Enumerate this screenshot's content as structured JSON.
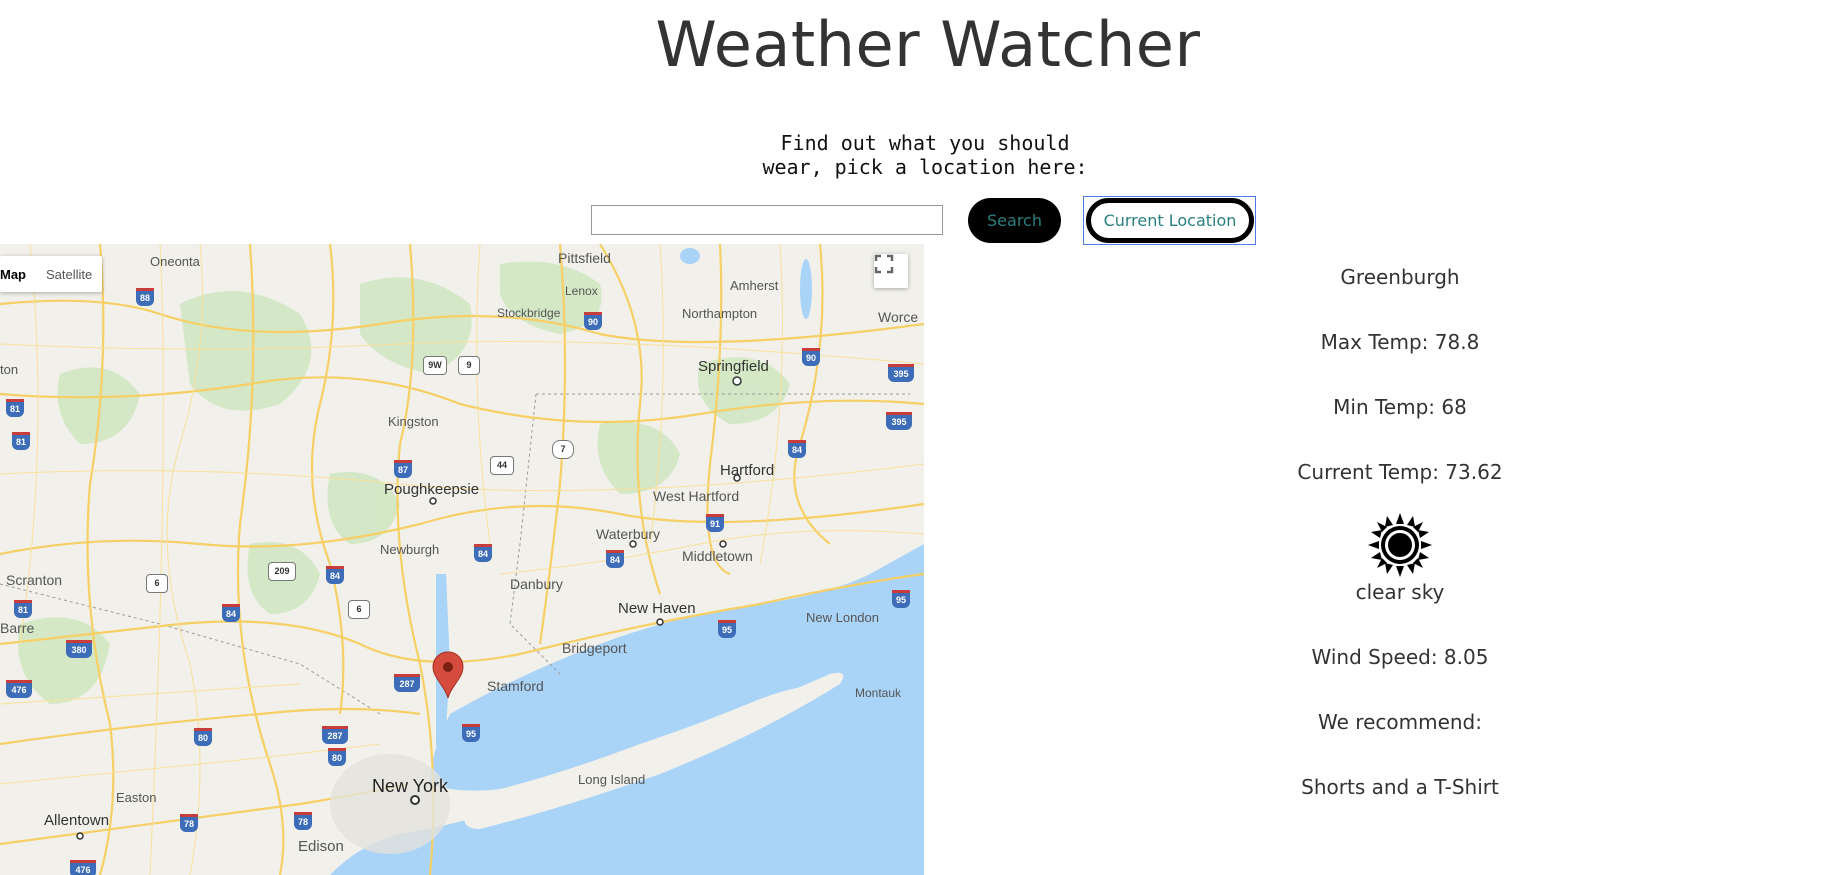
{
  "header": {
    "title": "Weather Watcher",
    "subtitle": "Find out what you should wear, pick a location here:"
  },
  "search": {
    "value": "",
    "placeholder": "",
    "search_label": "Search",
    "current_location_label": "Current Location"
  },
  "map": {
    "type_controls": [
      "Map",
      "Satellite"
    ],
    "active_type": "Map",
    "fullscreen_icon": "fullscreen-icon",
    "marker_icon": "map-pin-icon",
    "labels": {
      "oneonta": "Oneonta",
      "pittsfield": "Pittsfield",
      "amherst": "Amherst",
      "lenox": "Lenox",
      "stockbridge": "Stockbridge",
      "northampton": "Northampton",
      "worcester": "Worce",
      "springfield": "Springfield",
      "ton": "ton",
      "kingston": "Kingston",
      "hartford": "Hartford",
      "west_hartford": "West Hartford",
      "poughkeepsie": "Poughkeepsie",
      "waterbury": "Waterbury",
      "newburgh": "Newburgh",
      "middletown": "Middletown",
      "danbury": "Danbury",
      "scranton": "Scranton",
      "new_haven": "New Haven",
      "new_london": "New London",
      "barre": "Barre",
      "bridgeport": "Bridgeport",
      "stamford": "Stamford",
      "montauk": "Montauk",
      "long_island": "Long Island",
      "new_york": "New York",
      "easton": "Easton",
      "allentown": "Allentown",
      "edison": "Edison"
    },
    "shields": {
      "i88": "88",
      "i90a": "90",
      "i90b": "90",
      "i395a": "395",
      "i395b": "395",
      "us9w": "9W",
      "us9": "9",
      "i81a": "81",
      "i81b": "81",
      "i87": "87",
      "ct7": "7",
      "us44": "44",
      "i84a": "84",
      "i84b": "84",
      "i84c": "84",
      "i84d": "84",
      "i84e": "84",
      "i91": "91",
      "us6a": "6",
      "us6b": "6",
      "us209": "209",
      "i81c": "81",
      "i380": "380",
      "i287a": "287",
      "i287b": "287",
      "i95a": "95",
      "i95b": "95",
      "i95c": "95",
      "i80a": "80",
      "i80b": "80",
      "i476a": "476",
      "i476b": "476",
      "i78": "78"
    }
  },
  "weather": {
    "location": "Greenburgh",
    "max_temp": "Max Temp: 78.8",
    "min_temp": "Min Temp: 68",
    "current_temp": "Current Temp: 73.62",
    "condition_icon": "sun-icon",
    "condition": "clear sky",
    "wind_speed": "Wind Speed: 8.05",
    "recommend_label": "We recommend:",
    "recommendation": "Shorts and a T-Shirt"
  }
}
